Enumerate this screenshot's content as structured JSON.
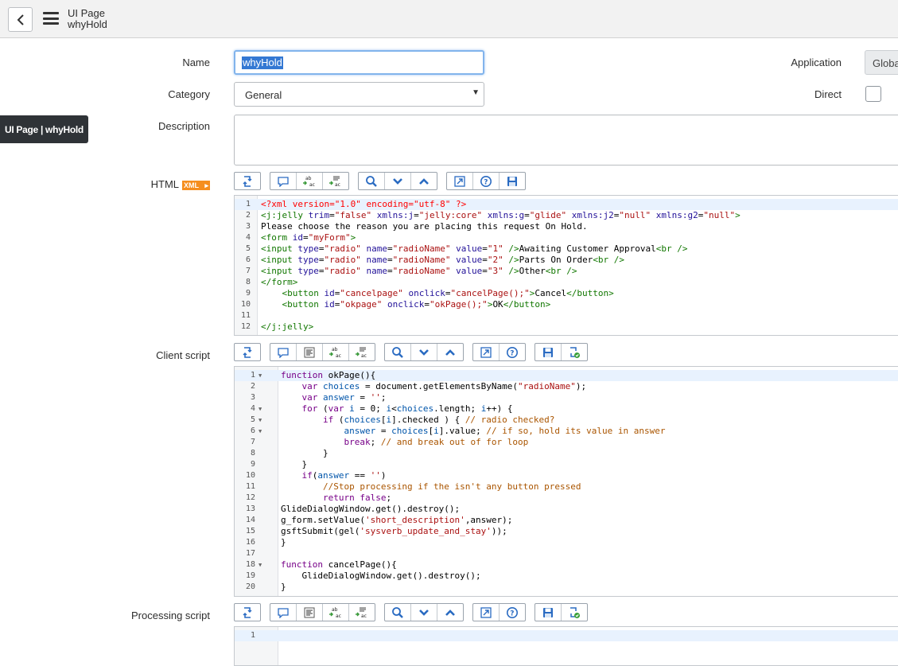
{
  "header": {
    "title": "UI Page",
    "record": "whyHold"
  },
  "tooltip": "UI Page | whyHold",
  "form": {
    "name_label": "Name",
    "name_value": "whyHold",
    "category_label": "Category",
    "category_value": "General",
    "description_label": "Description",
    "description_value": "",
    "application_label": "Application",
    "application_value": "Globa",
    "direct_label": "Direct",
    "direct_checked": false,
    "html_label": "HTML",
    "xml_badge": "XML",
    "client_script_label": "Client script",
    "processing_script_label": "Processing script"
  },
  "icons": {
    "back": "chevron-left-icon",
    "menu": "hamburger-menu-icon",
    "toolbar_html": [
      "toggle-syntax-icon",
      "comment-icon",
      "format-icon",
      "replace-icon",
      "search-icon",
      "find-next-icon",
      "find-previous-icon",
      "fullscreen-icon",
      "help-icon",
      "save-icon"
    ],
    "toolbar_script": [
      "toggle-syntax-icon",
      "comment-icon",
      "format-code-icon",
      "format-icon",
      "replace-icon",
      "search-icon",
      "find-next-icon",
      "find-previous-icon",
      "fullscreen-icon",
      "help-icon",
      "save-icon",
      "script-debugger-icon"
    ]
  },
  "html_code": [
    [
      {
        "t": "<?xml version=\"1.0\" encoding=\"utf-8\" ?>",
        "c": "pi"
      }
    ],
    [
      {
        "t": "<j:jelly",
        "c": "tag"
      },
      {
        "t": " trim",
        "c": "attr"
      },
      {
        "t": "=",
        "c": "txt"
      },
      {
        "t": "\"false\"",
        "c": "str"
      },
      {
        "t": " xmlns:j",
        "c": "attr"
      },
      {
        "t": "=",
        "c": "txt"
      },
      {
        "t": "\"jelly:core\"",
        "c": "str"
      },
      {
        "t": " xmlns:g",
        "c": "attr"
      },
      {
        "t": "=",
        "c": "txt"
      },
      {
        "t": "\"glide\"",
        "c": "str"
      },
      {
        "t": " xmlns:j2",
        "c": "attr"
      },
      {
        "t": "=",
        "c": "txt"
      },
      {
        "t": "\"null\"",
        "c": "str"
      },
      {
        "t": " xmlns:g2",
        "c": "attr"
      },
      {
        "t": "=",
        "c": "txt"
      },
      {
        "t": "\"null\"",
        "c": "str"
      },
      {
        "t": ">",
        "c": "tag"
      }
    ],
    [
      {
        "t": "Please choose the reason you are placing this request On Hold.",
        "c": "txt"
      }
    ],
    [
      {
        "t": "<form",
        "c": "tag"
      },
      {
        "t": " id",
        "c": "attr"
      },
      {
        "t": "=",
        "c": "txt"
      },
      {
        "t": "\"myForm\"",
        "c": "str"
      },
      {
        "t": ">",
        "c": "tag"
      }
    ],
    [
      {
        "t": "<input",
        "c": "tag"
      },
      {
        "t": " type",
        "c": "attr"
      },
      {
        "t": "=",
        "c": "txt"
      },
      {
        "t": "\"radio\"",
        "c": "str"
      },
      {
        "t": " name",
        "c": "attr"
      },
      {
        "t": "=",
        "c": "txt"
      },
      {
        "t": "\"radioName\"",
        "c": "str"
      },
      {
        "t": " value",
        "c": "attr"
      },
      {
        "t": "=",
        "c": "txt"
      },
      {
        "t": "\"1\"",
        "c": "str"
      },
      {
        "t": " />",
        "c": "tag"
      },
      {
        "t": "Awaiting Customer Approval",
        "c": "txt"
      },
      {
        "t": "<br />",
        "c": "tag"
      }
    ],
    [
      {
        "t": "<input",
        "c": "tag"
      },
      {
        "t": " type",
        "c": "attr"
      },
      {
        "t": "=",
        "c": "txt"
      },
      {
        "t": "\"radio\"",
        "c": "str"
      },
      {
        "t": " name",
        "c": "attr"
      },
      {
        "t": "=",
        "c": "txt"
      },
      {
        "t": "\"radioName\"",
        "c": "str"
      },
      {
        "t": " value",
        "c": "attr"
      },
      {
        "t": "=",
        "c": "txt"
      },
      {
        "t": "\"2\"",
        "c": "str"
      },
      {
        "t": " />",
        "c": "tag"
      },
      {
        "t": "Parts On Order",
        "c": "txt"
      },
      {
        "t": "<br />",
        "c": "tag"
      }
    ],
    [
      {
        "t": "<input",
        "c": "tag"
      },
      {
        "t": " type",
        "c": "attr"
      },
      {
        "t": "=",
        "c": "txt"
      },
      {
        "t": "\"radio\"",
        "c": "str"
      },
      {
        "t": " name",
        "c": "attr"
      },
      {
        "t": "=",
        "c": "txt"
      },
      {
        "t": "\"radioName\"",
        "c": "str"
      },
      {
        "t": " value",
        "c": "attr"
      },
      {
        "t": "=",
        "c": "txt"
      },
      {
        "t": "\"3\"",
        "c": "str"
      },
      {
        "t": " />",
        "c": "tag"
      },
      {
        "t": "Other",
        "c": "txt"
      },
      {
        "t": "<br />",
        "c": "tag"
      }
    ],
    [
      {
        "t": "</form>",
        "c": "tag"
      }
    ],
    [
      {
        "t": "    ",
        "c": "txt"
      },
      {
        "t": "<button",
        "c": "tag"
      },
      {
        "t": " id",
        "c": "attr"
      },
      {
        "t": "=",
        "c": "txt"
      },
      {
        "t": "\"cancelpage\"",
        "c": "str"
      },
      {
        "t": " onclick",
        "c": "attr"
      },
      {
        "t": "=",
        "c": "txt"
      },
      {
        "t": "\"cancelPage();\"",
        "c": "str"
      },
      {
        "t": ">",
        "c": "tag"
      },
      {
        "t": "Cancel",
        "c": "txt"
      },
      {
        "t": "</button>",
        "c": "tag"
      }
    ],
    [
      {
        "t": "    ",
        "c": "txt"
      },
      {
        "t": "<button",
        "c": "tag"
      },
      {
        "t": " id",
        "c": "attr"
      },
      {
        "t": "=",
        "c": "txt"
      },
      {
        "t": "\"okpage\"",
        "c": "str"
      },
      {
        "t": " onclick",
        "c": "attr"
      },
      {
        "t": "=",
        "c": "txt"
      },
      {
        "t": "\"okPage();\"",
        "c": "str"
      },
      {
        "t": ">",
        "c": "tag"
      },
      {
        "t": "OK",
        "c": "txt"
      },
      {
        "t": "</button>",
        "c": "tag"
      }
    ],
    [],
    [
      {
        "t": "</j:jelly>",
        "c": "tag"
      }
    ]
  ],
  "client_code": [
    {
      "f": true,
      "s": [
        {
          "t": "function",
          "c": "kw"
        },
        {
          "t": " okPage(){",
          "c": "txt"
        }
      ]
    },
    {
      "f": false,
      "s": [
        {
          "t": "    ",
          "c": "txt"
        },
        {
          "t": "var",
          "c": "kw"
        },
        {
          "t": " ",
          "c": "txt"
        },
        {
          "t": "choices",
          "c": "var"
        },
        {
          "t": " = document.getElementsByName(",
          "c": "txt"
        },
        {
          "t": "\"radioName\"",
          "c": "strjs"
        },
        {
          "t": ");",
          "c": "txt"
        }
      ]
    },
    {
      "f": false,
      "s": [
        {
          "t": "    ",
          "c": "txt"
        },
        {
          "t": "var",
          "c": "kw"
        },
        {
          "t": " ",
          "c": "txt"
        },
        {
          "t": "answer",
          "c": "var"
        },
        {
          "t": " = ",
          "c": "txt"
        },
        {
          "t": "''",
          "c": "strjs"
        },
        {
          "t": ";",
          "c": "txt"
        }
      ]
    },
    {
      "f": true,
      "s": [
        {
          "t": "    ",
          "c": "txt"
        },
        {
          "t": "for",
          "c": "kw"
        },
        {
          "t": " (",
          "c": "txt"
        },
        {
          "t": "var",
          "c": "kw"
        },
        {
          "t": " ",
          "c": "txt"
        },
        {
          "t": "i",
          "c": "var"
        },
        {
          "t": " = 0; ",
          "c": "txt"
        },
        {
          "t": "i",
          "c": "var"
        },
        {
          "t": "<",
          "c": "txt"
        },
        {
          "t": "choices",
          "c": "var"
        },
        {
          "t": ".length; ",
          "c": "txt"
        },
        {
          "t": "i",
          "c": "var"
        },
        {
          "t": "++) {",
          "c": "txt"
        }
      ]
    },
    {
      "f": true,
      "s": [
        {
          "t": "        ",
          "c": "txt"
        },
        {
          "t": "if",
          "c": "kw"
        },
        {
          "t": " (",
          "c": "txt"
        },
        {
          "t": "choices",
          "c": "var"
        },
        {
          "t": "[",
          "c": "txt"
        },
        {
          "t": "i",
          "c": "var"
        },
        {
          "t": "].checked ) { ",
          "c": "txt"
        },
        {
          "t": "// radio checked?",
          "c": "cm"
        }
      ]
    },
    {
      "f": true,
      "s": [
        {
          "t": "            ",
          "c": "txt"
        },
        {
          "t": "answer",
          "c": "var"
        },
        {
          "t": " = ",
          "c": "txt"
        },
        {
          "t": "choices",
          "c": "var"
        },
        {
          "t": "[",
          "c": "txt"
        },
        {
          "t": "i",
          "c": "var"
        },
        {
          "t": "].value; ",
          "c": "txt"
        },
        {
          "t": "// if so, hold its value in answer",
          "c": "cm"
        }
      ]
    },
    {
      "f": false,
      "s": [
        {
          "t": "            ",
          "c": "txt"
        },
        {
          "t": "break",
          "c": "kw"
        },
        {
          "t": "; ",
          "c": "txt"
        },
        {
          "t": "// and break out of for loop",
          "c": "cm"
        }
      ]
    },
    {
      "f": false,
      "s": [
        {
          "t": "        }",
          "c": "txt"
        }
      ]
    },
    {
      "f": false,
      "s": [
        {
          "t": "    }",
          "c": "txt"
        }
      ]
    },
    {
      "f": false,
      "s": [
        {
          "t": "    ",
          "c": "txt"
        },
        {
          "t": "if",
          "c": "kw"
        },
        {
          "t": "(",
          "c": "txt"
        },
        {
          "t": "answer",
          "c": "var"
        },
        {
          "t": " == ",
          "c": "txt"
        },
        {
          "t": "''",
          "c": "strjs"
        },
        {
          "t": ")",
          "c": "txt"
        }
      ]
    },
    {
      "f": false,
      "s": [
        {
          "t": "        ",
          "c": "txt"
        },
        {
          "t": "//Stop processing if the isn't any button pressed",
          "c": "cm"
        }
      ]
    },
    {
      "f": false,
      "s": [
        {
          "t": "        ",
          "c": "txt"
        },
        {
          "t": "return",
          "c": "kw"
        },
        {
          "t": " ",
          "c": "txt"
        },
        {
          "t": "false",
          "c": "kw"
        },
        {
          "t": ";",
          "c": "txt"
        }
      ]
    },
    {
      "f": false,
      "s": [
        {
          "t": "GlideDialogWindow.get().destroy();",
          "c": "txt"
        }
      ]
    },
    {
      "f": false,
      "s": [
        {
          "t": "g_form.setValue(",
          "c": "txt"
        },
        {
          "t": "'short_description'",
          "c": "strjs"
        },
        {
          "t": ",answer);",
          "c": "txt"
        }
      ]
    },
    {
      "f": false,
      "s": [
        {
          "t": "gsftSubmit(gel(",
          "c": "txt"
        },
        {
          "t": "'sysverb_update_and_stay'",
          "c": "strjs"
        },
        {
          "t": "));",
          "c": "txt"
        }
      ]
    },
    {
      "f": false,
      "s": [
        {
          "t": "}",
          "c": "txt"
        }
      ]
    },
    {
      "f": false,
      "s": []
    },
    {
      "f": true,
      "s": [
        {
          "t": "function",
          "c": "kw"
        },
        {
          "t": " cancelPage(){",
          "c": "txt"
        }
      ]
    },
    {
      "f": false,
      "s": [
        {
          "t": "    GlideDialogWindow.get().destroy();",
          "c": "txt"
        }
      ]
    },
    {
      "f": false,
      "s": [
        {
          "t": "}",
          "c": "txt"
        }
      ]
    }
  ],
  "processing_code": [
    "1"
  ]
}
